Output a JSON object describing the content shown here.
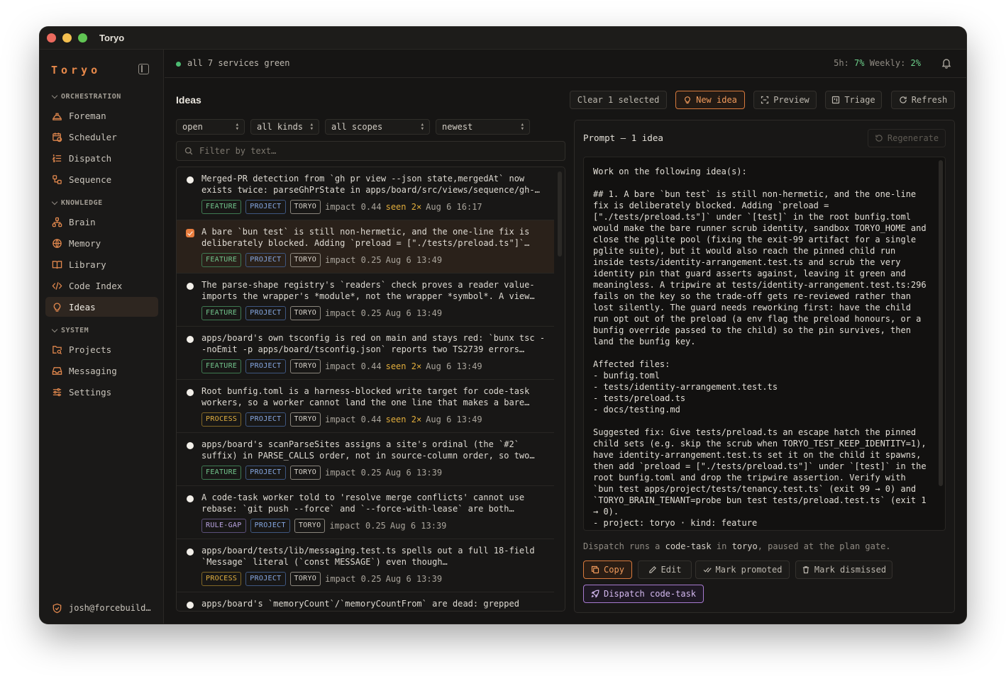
{
  "window": {
    "title": "Toryo"
  },
  "sidebar": {
    "brand": "Toryo",
    "sections": [
      {
        "label": "ORCHESTRATION",
        "items": [
          {
            "label": "Foreman",
            "icon": "hard-hat-icon"
          },
          {
            "label": "Scheduler",
            "icon": "calendar-clock-icon"
          },
          {
            "label": "Dispatch",
            "icon": "list-ordered-icon"
          },
          {
            "label": "Sequence",
            "icon": "workflow-icon"
          }
        ]
      },
      {
        "label": "KNOWLEDGE",
        "items": [
          {
            "label": "Brain",
            "icon": "network-icon"
          },
          {
            "label": "Memory",
            "icon": "globe-brain-icon"
          },
          {
            "label": "Library",
            "icon": "book-open-icon"
          },
          {
            "label": "Code Index",
            "icon": "code-icon"
          },
          {
            "label": "Ideas",
            "icon": "lightbulb-icon",
            "active": true
          }
        ]
      },
      {
        "label": "SYSTEM",
        "items": [
          {
            "label": "Projects",
            "icon": "folder-search-icon"
          },
          {
            "label": "Messaging",
            "icon": "inbox-icon"
          },
          {
            "label": "Settings",
            "icon": "sliders-icon"
          }
        ]
      }
    ],
    "user": "josh@forcebuild…"
  },
  "topbar": {
    "status": "all 7 services green",
    "usage_5h_label": "5h:",
    "usage_5h": "7%",
    "usage_weekly_label": "Weekly:",
    "usage_weekly": "2%"
  },
  "ideas": {
    "title": "Ideas",
    "actions": {
      "clear": "Clear 1 selected",
      "new_idea": "New idea",
      "preview": "Preview",
      "triage": "Triage",
      "refresh": "Refresh"
    },
    "filters": {
      "status": "open",
      "kind": "all kinds",
      "scope": "all scopes",
      "sort": "newest",
      "search_placeholder": "Filter by text…"
    },
    "rows": [
      {
        "line1": "Merged-PR detection from `gh pr view --json state,mergedAt` now",
        "line2": "exists twice: parseGhPrState in apps/board/src/views/sequence/gh-…",
        "kind": "FEATURE",
        "scope": "PROJECT",
        "project": "TORYO",
        "impact": "impact 0.44",
        "seen": "seen 2×",
        "date": "Aug 6 16:17"
      },
      {
        "line1": "A bare `bun test` is still non-hermetic, and the one-line fix is",
        "line2": "deliberately blocked. Adding `preload = [\"./tests/preload.ts\"]`…",
        "kind": "FEATURE",
        "scope": "PROJECT",
        "project": "TORYO",
        "impact": "impact 0.25",
        "seen": "",
        "date": "Aug 6 13:49",
        "selected": true
      },
      {
        "line1": "The parse-shape registry's `readers` check proves a reader value-",
        "line2": "imports the wrapper's *module*, not the wrapper *symbol*. A view…",
        "kind": "FEATURE",
        "scope": "PROJECT",
        "project": "TORYO",
        "impact": "impact 0.25",
        "seen": "",
        "date": "Aug 6 13:49"
      },
      {
        "line1": "apps/board's own tsconfig is red on main and stays red: `bunx tsc -",
        "line2": "-noEmit -p apps/board/tsconfig.json` reports two TS2739 errors…",
        "kind": "FEATURE",
        "scope": "PROJECT",
        "project": "TORYO",
        "impact": "impact 0.44",
        "seen": "seen 2×",
        "date": "Aug 6 13:49"
      },
      {
        "line1": "Root bunfig.toml is a harness-blocked write target for code-task",
        "line2": "workers, so a worker cannot land the one line that makes a bare…",
        "kind": "PROCESS",
        "scope": "PROJECT",
        "project": "TORYO",
        "impact": "impact 0.44",
        "seen": "seen 2×",
        "date": "Aug 6 13:49"
      },
      {
        "line1": "apps/board's scanParseSites assigns a site's ordinal (the `#2`",
        "line2": "suffix) in PARSE_CALLS order, not in source-column order, so two…",
        "kind": "FEATURE",
        "scope": "PROJECT",
        "project": "TORYO",
        "impact": "impact 0.25",
        "seen": "",
        "date": "Aug 6 13:39"
      },
      {
        "line1": "A code-task worker told to 'resolve merge conflicts' cannot use",
        "line2": "rebase: `git push --force` and `--force-with-lease` are both…",
        "kind": "RULE-GAP",
        "scope": "PROJECT",
        "project": "TORYO",
        "impact": "impact 0.25",
        "seen": "",
        "date": "Aug 6 13:39"
      },
      {
        "line1": "apps/board/tests/lib/messaging.test.ts spells out a full 18-field",
        "line2": "`Message` literal (`const MESSAGE`) even though…",
        "kind": "PROCESS",
        "scope": "PROJECT",
        "project": "TORYO",
        "impact": "impact 0.25",
        "seen": "",
        "date": "Aug 6 13:39"
      },
      {
        "line1": "apps/board's `memoryCount`/`memoryCountFrom` are dead: grepped",
        "line2": "",
        "kind": "",
        "scope": "",
        "project": "",
        "impact": "",
        "seen": "",
        "date": ""
      }
    ]
  },
  "prompt_panel": {
    "title": "Prompt — 1 idea",
    "regenerate": "Regenerate",
    "text": "Work on the following idea(s):\n\n## 1. A bare `bun test` is still non-hermetic, and the one-line\nfix is deliberately blocked. Adding `preload =\n[\"./tests/preload.ts\"]` under `[test]` in the root bunfig.toml\nwould make the bare runner scrub identity, sandbox TORYO_HOME and\nclose the pglite pool (fixing the exit-99 artifact for a single\npglite suite), but it would also reach the pinned child run\ninside tests/identity-arrangement.test.ts and scrub the very\nidentity pin that guard asserts against, leaving it green and\nmeaningless. A tripwire at tests/identity-arrangement.test.ts:296\nfails on the key so the trade-off gets re-reviewed rather than\nlost silently. The guard needs reworking first: have the child\nrun opt out of the preload (a env flag the preload honours, or a\nbunfig override passed to the child) so the pin survives, then\nland the bunfig key.\n\nAffected files:\n- bunfig.toml\n- tests/identity-arrangement.test.ts\n- tests/preload.ts\n- docs/testing.md\n\nSuggested fix: Give tests/preload.ts an escape hatch the pinned\nchild sets (e.g. skip the scrub when TORYO_TEST_KEEP_IDENTITY=1),\nhave identity-arrangement.test.ts set it on the child it spawns,\nthen add `preload = [\"./tests/preload.ts\"]` under `[test]` in the\nroot bunfig.toml and drop the tripwire assertion. Verify with\n`bun test apps/project/tests/tenancy.test.ts` (exit 99 → 0) and\n`TORYO_BRAIN_TENANT=probe bun test tests/preload.test.ts` (exit 1\n→ 0).\n- project: toryo · kind: feature",
    "dispatch_prefix": "Dispatch runs a",
    "dispatch_kind": "code-task",
    "dispatch_mid": "in",
    "dispatch_project": "toryo",
    "dispatch_suffix": ", paused at the plan gate.",
    "buttons": {
      "copy": "Copy",
      "edit": "Edit",
      "promote": "Mark promoted",
      "dismiss": "Mark dismissed",
      "dispatch": "Dispatch code-task"
    }
  },
  "colors": {
    "accent": "#e8894a",
    "success": "#4cbb72",
    "background": "#161514"
  }
}
